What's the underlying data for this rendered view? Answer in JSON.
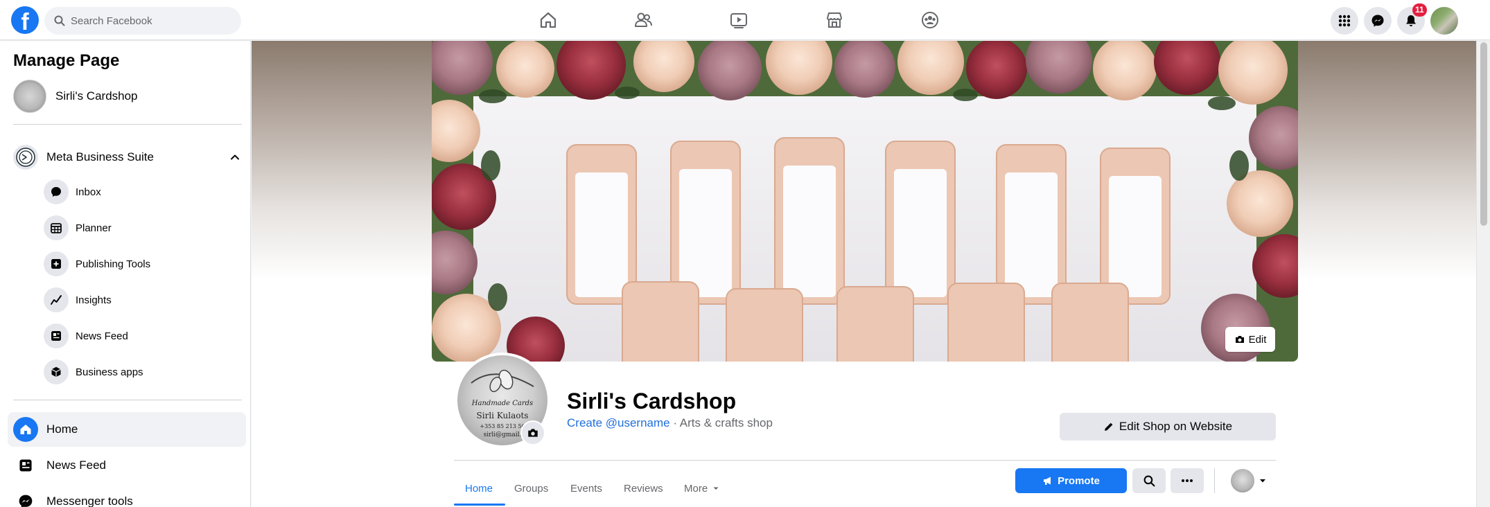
{
  "topbar": {
    "logo": "f",
    "search_placeholder": "Search Facebook",
    "notification_count": "11",
    "nav_icons": [
      "home-icon",
      "friends-icon",
      "watch-icon",
      "marketplace-icon",
      "groups-icon"
    ]
  },
  "sidebar": {
    "title": "Manage Page",
    "page_name": "Sirli's Cardshop",
    "suite_label": "Meta Business Suite",
    "sub_items": [
      {
        "label": "Inbox",
        "icon": "chat-bubble-icon"
      },
      {
        "label": "Planner",
        "icon": "calendar-icon"
      },
      {
        "label": "Publishing Tools",
        "icon": "publishing-tools-icon"
      },
      {
        "label": "Insights",
        "icon": "insights-icon"
      },
      {
        "label": "News Feed",
        "icon": "news-feed-icon"
      },
      {
        "label": "Business apps",
        "icon": "cube-icon"
      }
    ],
    "nav_items": [
      {
        "label": "Home",
        "icon": "home-icon",
        "active": true
      },
      {
        "label": "News Feed",
        "icon": "news-feed-icon",
        "active": false
      },
      {
        "label": "Messenger tools",
        "icon": "messenger-icon",
        "active": false
      }
    ]
  },
  "cover": {
    "edit_label": "Edit"
  },
  "profile": {
    "pic_text_line1": "Handmade Cards",
    "pic_text_line2": "Sirli Kulaots",
    "pic_text_line3": "+353 85 213 56",
    "pic_text_line4": "sirli@gmail."
  },
  "page": {
    "title": "Sirli's Cardshop",
    "username_link": "Create @username",
    "category": " · Arts & crafts shop",
    "edit_shop_label": "Edit Shop on Website"
  },
  "tabs": [
    {
      "label": "Home",
      "active": true
    },
    {
      "label": "Groups",
      "active": false
    },
    {
      "label": "Events",
      "active": false
    },
    {
      "label": "Reviews",
      "active": false
    },
    {
      "label": "More",
      "active": false
    }
  ],
  "actions": {
    "promote_label": "Promote"
  },
  "colors": {
    "brand": "#1877f2",
    "badge": "#e41e3f",
    "link": "#216fdb"
  }
}
